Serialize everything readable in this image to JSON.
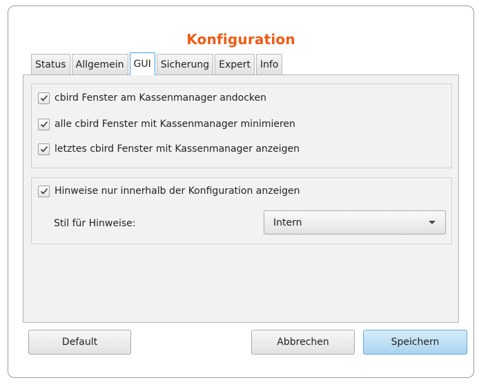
{
  "dialog": {
    "title": "Konfiguration"
  },
  "tabs": [
    {
      "label": "Status"
    },
    {
      "label": "Allgemein"
    },
    {
      "label": "GUI",
      "active": true
    },
    {
      "label": "Sicherung"
    },
    {
      "label": "Expert"
    },
    {
      "label": "Info"
    }
  ],
  "window_options": {
    "items": [
      {
        "label": "cbird Fenster am Kassenmanager andocken",
        "checked": true
      },
      {
        "label": "alle cbird Fenster mit Kassenmanager minimieren",
        "checked": true
      },
      {
        "label": "letztes cbird Fenster mit Kassenmanager anzeigen",
        "checked": true
      }
    ]
  },
  "hints": {
    "only_in_config": {
      "label": "Hinweise nur innerhalb der Konfiguration anzeigen",
      "checked": true
    },
    "style_label": "Stil für Hinweise:",
    "style_value": "Intern"
  },
  "buttons": {
    "default": "Default",
    "cancel": "Abbrechen",
    "save": "Speichern"
  },
  "colors": {
    "title": "#f05b14",
    "active_tab_border": "#3c9fe0",
    "primary_button": "#a9d4f0"
  }
}
